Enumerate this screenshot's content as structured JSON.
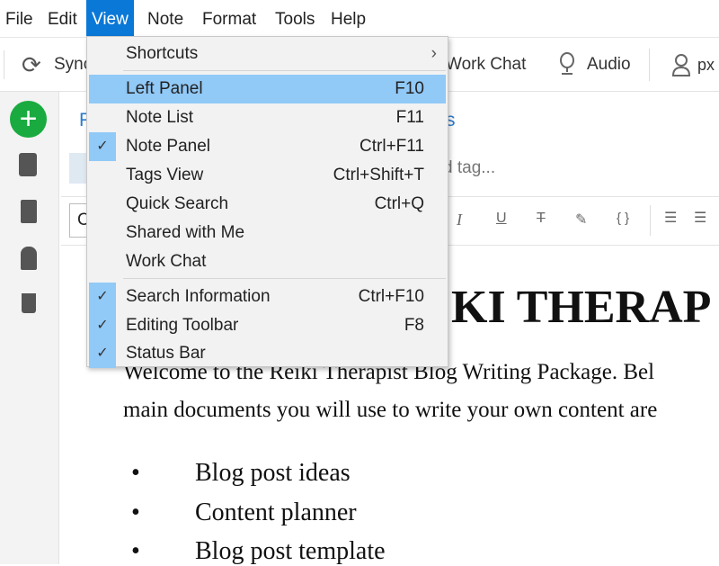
{
  "menubar": {
    "items": [
      "File",
      "Edit",
      "View",
      "Note",
      "Format",
      "Tools",
      "Help"
    ],
    "active": "View"
  },
  "toolbar": {
    "sync": "Sync",
    "work_chat": "Work Chat",
    "audio": "Audio",
    "user": "px"
  },
  "note": {
    "title_partial": "F",
    "title_partial_end": "s",
    "tag_placeholder": "d tag...",
    "font_select_partial": "C",
    "heading_partial": "KI THERAP",
    "paragraph_line1": "Welcome to the Reiki Therapist Blog Writing Package. Bel",
    "paragraph_line2": "main documents you will use to write your own content are",
    "list": [
      "Blog post ideas",
      "Content planner",
      "Blog post template"
    ]
  },
  "view_menu": {
    "shortcuts": "Shortcuts",
    "items": [
      {
        "label": "Left Panel",
        "shortcut": "F10",
        "checked": false,
        "highlighted": true
      },
      {
        "label": "Note List",
        "shortcut": "F11",
        "checked": false
      },
      {
        "label": "Note Panel",
        "shortcut": "Ctrl+F11",
        "checked": true
      },
      {
        "label": "Tags View",
        "shortcut": "Ctrl+Shift+T",
        "checked": false
      },
      {
        "label": "Quick Search",
        "shortcut": "Ctrl+Q",
        "checked": false
      },
      {
        "label": "Shared with Me",
        "shortcut": "",
        "checked": false
      },
      {
        "label": "Work Chat",
        "shortcut": "",
        "checked": false
      },
      {
        "label": "Search Information",
        "shortcut": "Ctrl+F10",
        "checked": true
      },
      {
        "label": "Editing Toolbar",
        "shortcut": "F8",
        "checked": true
      },
      {
        "label": "Status Bar",
        "shortcut": "",
        "checked": true
      }
    ]
  },
  "colors": {
    "accent": "#0a78d7",
    "highlight": "#91c9f7",
    "new_button": "#1aab40",
    "link": "#2a7bd0"
  }
}
